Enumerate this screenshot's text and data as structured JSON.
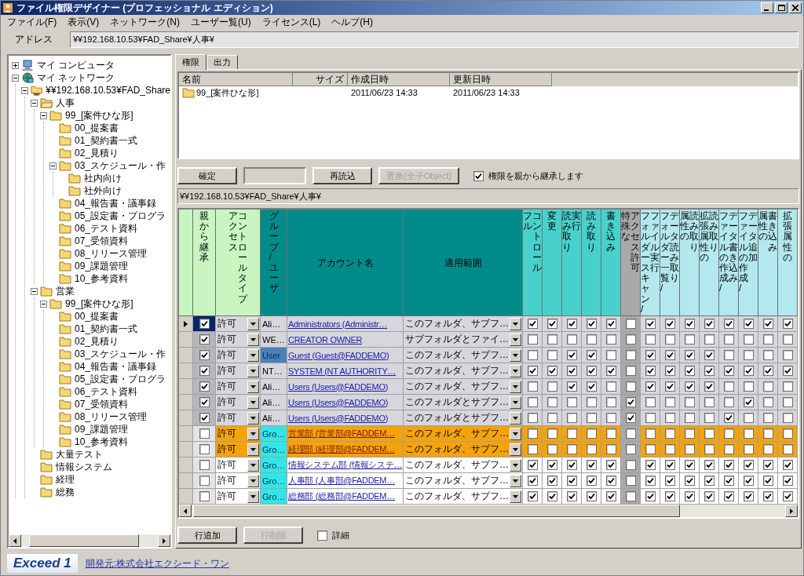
{
  "window": {
    "title": "ファイル権限デザイナー (プロフェッショナル エディション)"
  },
  "menu": [
    "ファイル(F)",
    "表示(V)",
    "ネットワーク(N)",
    "ユーザー覧(U)",
    "ライセンス(L)",
    "ヘルプ(H)"
  ],
  "address": {
    "label": "アドレス",
    "value": "¥¥192.168.10.53¥FAD_Share¥人事¥"
  },
  "tree": [
    {
      "label": "マイ コンピュータ",
      "kind": "computer",
      "expanded": false
    },
    {
      "label": "マイ ネットワーク",
      "kind": "network",
      "expanded": true,
      "children": [
        {
          "label": "¥¥192.168.10.53¥FAD_Share",
          "kind": "share",
          "expanded": true,
          "children": [
            {
              "label": "人事",
              "kind": "folder_open",
              "expanded": true,
              "children": [
                {
                  "label": "99_[案件ひな形]",
                  "kind": "folder",
                  "expanded": true,
                  "children": [
                    {
                      "label": "00_提案書",
                      "kind": "folder"
                    },
                    {
                      "label": "01_契約書一式",
                      "kind": "folder"
                    },
                    {
                      "label": "02_見積り",
                      "kind": "folder"
                    },
                    {
                      "label": "03_スケジュール・作",
                      "kind": "folder",
                      "expanded": true,
                      "children": [
                        {
                          "label": "社内向け",
                          "kind": "folder"
                        },
                        {
                          "label": "社外向け",
                          "kind": "folder"
                        }
                      ]
                    },
                    {
                      "label": "04_報告書・議事録",
                      "kind": "folder"
                    },
                    {
                      "label": "05_設定書・プログラ",
                      "kind": "folder"
                    },
                    {
                      "label": "06_テスト資料",
                      "kind": "folder"
                    },
                    {
                      "label": "07_受領資料",
                      "kind": "folder"
                    },
                    {
                      "label": "08_リリース管理",
                      "kind": "folder"
                    },
                    {
                      "label": "09_課題管理",
                      "kind": "folder"
                    },
                    {
                      "label": "10_参考資料",
                      "kind": "folder"
                    }
                  ]
                }
              ]
            },
            {
              "label": "営業",
              "kind": "folder",
              "expanded": true,
              "children": [
                {
                  "label": "99_[案件ひな形]",
                  "kind": "folder",
                  "expanded": true,
                  "children": [
                    {
                      "label": "00_提案書",
                      "kind": "folder"
                    },
                    {
                      "label": "01_契約書一式",
                      "kind": "folder"
                    },
                    {
                      "label": "02_見積り",
                      "kind": "folder"
                    },
                    {
                      "label": "03_スケジュール・作",
                      "kind": "folder"
                    },
                    {
                      "label": "04_報告書・議事録",
                      "kind": "folder"
                    },
                    {
                      "label": "05_設定書・プログラ",
                      "kind": "folder"
                    },
                    {
                      "label": "06_テスト資料",
                      "kind": "folder"
                    },
                    {
                      "label": "07_受領資料",
                      "kind": "folder"
                    },
                    {
                      "label": "08_リリース管理",
                      "kind": "folder"
                    },
                    {
                      "label": "09_課題管理",
                      "kind": "folder"
                    },
                    {
                      "label": "10_参考資料",
                      "kind": "folder"
                    }
                  ]
                }
              ]
            },
            {
              "label": "大量テスト",
              "kind": "folder"
            },
            {
              "label": "情報システム",
              "kind": "folder"
            },
            {
              "label": "経理",
              "kind": "folder"
            },
            {
              "label": "総務",
              "kind": "folder"
            }
          ]
        }
      ]
    }
  ],
  "tabs": [
    {
      "label": "権限",
      "selected": true
    },
    {
      "label": "出力",
      "selected": false
    }
  ],
  "file_list": {
    "columns": [
      "名前",
      "サイズ",
      "作成日時",
      "更新日時"
    ],
    "rows": [
      {
        "name": "99_[案件ひな形]",
        "created": "2011/06/23 14:33",
        "modified": "2011/06/23 14:33"
      }
    ]
  },
  "toolbar": [
    {
      "kind": "button",
      "label": "確定",
      "disabled": false
    },
    {
      "kind": "field"
    },
    {
      "kind": "button",
      "label": "再読込",
      "disabled": false
    },
    {
      "kind": "button",
      "label": "置換(全子Object)",
      "disabled": true
    },
    {
      "kind": "checkbox",
      "label": "権限を親から継承します",
      "checked": true
    }
  ],
  "path": "¥¥192.168.10.53¥FAD_Share¥人事¥",
  "grid": {
    "columns": [
      {
        "kind": "inherit",
        "lines": [
          "親から継承"
        ]
      },
      {
        "kind": "type",
        "lines": [
          "アクセス",
          "コントロールタイプ"
        ]
      },
      {
        "kind": "group",
        "lines": [
          "グループ/ユーザ"
        ]
      },
      {
        "kind": "account",
        "lines": [
          "アカウント名"
        ]
      },
      {
        "kind": "scope",
        "lines": [
          "適用範囲"
        ]
      },
      {
        "kind": "perm",
        "lines": [
          "フル",
          "コントロール"
        ]
      },
      {
        "kind": "perm",
        "lines": [
          "変更"
        ]
      },
      {
        "kind": "perm",
        "lines": [
          "読み取り",
          "実行"
        ]
      },
      {
        "kind": "perm",
        "lines": [
          "読み取り"
        ]
      },
      {
        "kind": "perm",
        "lines": [
          "書き込み"
        ]
      },
      {
        "kind": "special",
        "lines": [
          "特殊な",
          "アクセス許可"
        ]
      },
      {
        "kind": "detail",
        "lines": [
          "フォルダースキャン/",
          "ファイル実行"
        ]
      },
      {
        "kind": "detail",
        "lines": [
          "フォルダー一覧/",
          "データ読み取り"
        ]
      },
      {
        "kind": "detail",
        "lines": [
          "属性の",
          "読み取り"
        ]
      },
      {
        "kind": "detail",
        "lines": [
          "拡張属性の",
          "読み取り"
        ]
      },
      {
        "kind": "detail",
        "lines": [
          "ファイルの作成/",
          "データ書き込み"
        ]
      },
      {
        "kind": "detail",
        "lines": [
          "ファイルの作成/",
          "データ追加"
        ]
      },
      {
        "kind": "detail",
        "lines": [
          "属性の",
          "書き込み"
        ]
      },
      {
        "kind": "detail",
        "lines": [
          "拡張属性の"
        ]
      }
    ],
    "rows": [
      {
        "selected": true,
        "kind": "inherited",
        "inherit": true,
        "type": "許可",
        "group": "Ali…",
        "account": "Administrators (Administr…",
        "scope": "このフォルダ、サブフ…",
        "perms": [
          true,
          true,
          true,
          true,
          true,
          false,
          true,
          true,
          true,
          true,
          true,
          true,
          true,
          true
        ]
      },
      {
        "selected": false,
        "kind": "inherited",
        "inherit": true,
        "type": "許可",
        "group": "WE…",
        "account": "CREATOR OWNER",
        "scope": "サブフォルダとファイ…",
        "perms": [
          false,
          false,
          false,
          false,
          false,
          false,
          false,
          false,
          false,
          false,
          false,
          false,
          false,
          false
        ]
      },
      {
        "selected": false,
        "kind": "inherited",
        "inherit": true,
        "type": "許可",
        "group": "User",
        "color": "#4a82b8",
        "account": "Guest (Guest@FADDEMO)",
        "scope": "このフォルダ、サブフ…",
        "perms": [
          false,
          false,
          true,
          true,
          false,
          false,
          true,
          true,
          true,
          true,
          false,
          false,
          false,
          false
        ]
      },
      {
        "selected": false,
        "kind": "inherited",
        "inherit": true,
        "type": "許可",
        "group": "NT…",
        "account": "SYSTEM (NT AUTHORITY…",
        "scope": "このフォルダ、サブフ…",
        "perms": [
          true,
          true,
          true,
          true,
          true,
          false,
          true,
          true,
          true,
          true,
          true,
          true,
          true,
          true
        ]
      },
      {
        "selected": false,
        "kind": "inherited",
        "inherit": true,
        "type": "許可",
        "group": "Ali…",
        "account": "Users (Users@FADDEMO)",
        "scope": "このフォルダ、サブフ…",
        "perms": [
          false,
          false,
          true,
          true,
          false,
          false,
          true,
          true,
          true,
          true,
          false,
          false,
          false,
          false
        ]
      },
      {
        "selected": false,
        "kind": "inherited",
        "inherit": true,
        "type": "許可",
        "group": "Ali…",
        "account": "Users (Users@FADDEMO)",
        "scope": "このフォルダとサブフ…",
        "perms": [
          false,
          false,
          false,
          false,
          false,
          true,
          false,
          false,
          false,
          false,
          false,
          true,
          false,
          false
        ]
      },
      {
        "selected": false,
        "kind": "inherited",
        "inherit": true,
        "type": "許可",
        "group": "Ali…",
        "account": "Users (Users@FADDEMO)",
        "scope": "このフォルダとサブフ…",
        "perms": [
          false,
          false,
          false,
          false,
          false,
          true,
          false,
          false,
          false,
          false,
          true,
          false,
          false,
          false
        ]
      },
      {
        "selected": false,
        "kind": "warning",
        "inherit": false,
        "type": "許可",
        "group": "Gro…",
        "color": "#33e6e6",
        "account": "営業部 (営業部@FADDEM…",
        "scope": "このフォルダ、サブフ…",
        "perms": [
          false,
          false,
          false,
          false,
          false,
          false,
          false,
          false,
          false,
          false,
          false,
          false,
          false,
          false
        ]
      },
      {
        "selected": false,
        "kind": "warning",
        "inherit": false,
        "type": "許可",
        "group": "Gro…",
        "color": "#33e6e6",
        "account": "経理部 (経理部@FADDEM…",
        "scope": "このフォルダ、サブフ…",
        "perms": [
          false,
          false,
          false,
          false,
          false,
          false,
          false,
          false,
          false,
          false,
          false,
          false,
          false,
          false
        ]
      },
      {
        "selected": false,
        "kind": "own",
        "inherit": false,
        "type": "許可",
        "group": "Gro…",
        "color": "#33e6e6",
        "account": "情報システム部 (情報システ…",
        "scope": "このフォルダ、サブフ…",
        "perms": [
          true,
          true,
          true,
          true,
          true,
          false,
          true,
          true,
          true,
          true,
          true,
          true,
          true,
          true
        ]
      },
      {
        "selected": false,
        "kind": "own",
        "inherit": false,
        "type": "許可",
        "group": "Gro…",
        "color": "#33e6e6",
        "account": "人事部 (人事部@FADDEM…",
        "scope": "このフォルダ、サブフ…",
        "perms": [
          true,
          true,
          true,
          true,
          true,
          false,
          true,
          true,
          true,
          true,
          true,
          true,
          true,
          true
        ]
      },
      {
        "selected": false,
        "kind": "own",
        "inherit": false,
        "type": "許可",
        "group": "Gro…",
        "color": "#33e6e6",
        "account": "総務部 (総務部@FADDEM…",
        "scope": "このフォルダ、サブフ…",
        "perms": [
          true,
          true,
          true,
          true,
          true,
          false,
          true,
          true,
          true,
          true,
          true,
          true,
          true,
          true
        ]
      }
    ]
  },
  "bottom_toolbar": [
    {
      "kind": "button",
      "label": "行追加",
      "disabled": false
    },
    {
      "kind": "button",
      "label": "行削除",
      "disabled": true
    },
    {
      "kind": "checkbox",
      "label": "詳細",
      "checked": false
    }
  ],
  "footer": {
    "logo": "Exceed 1",
    "link": "開発元:株式会社エクシード・ワン"
  }
}
